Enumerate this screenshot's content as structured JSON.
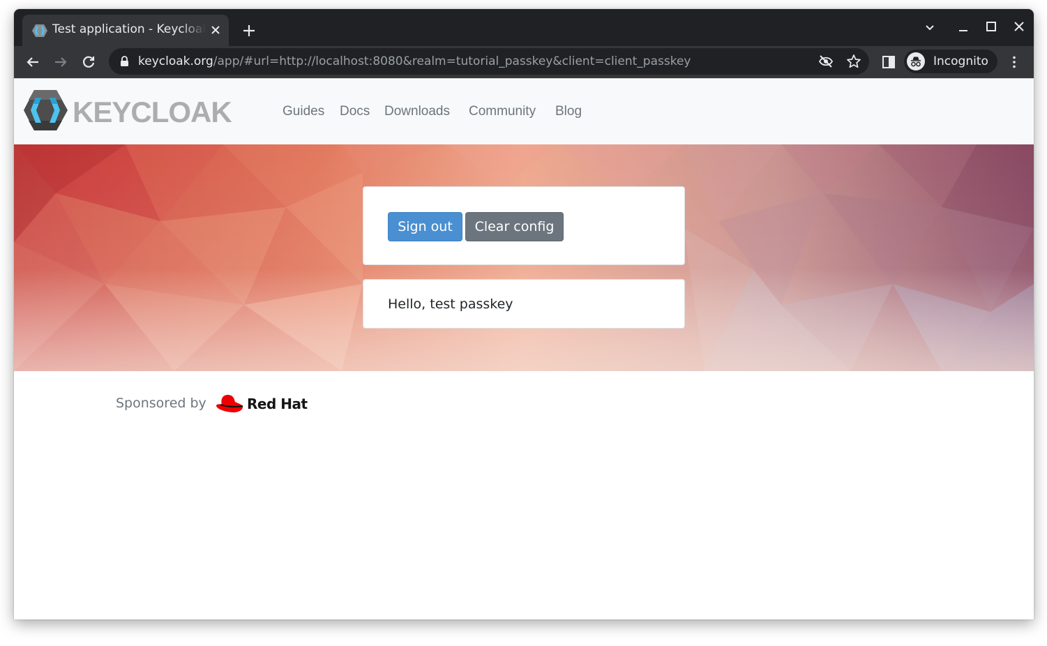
{
  "browser": {
    "tab_title": "Test application - Keycloak",
    "url_host": "keycloak.org",
    "url_rest": "/app/#url=http://localhost:8080&realm=tutorial_passkey&client=client_passkey",
    "profile_label": "Incognito"
  },
  "site": {
    "logo_text": "KEYCLOAK",
    "nav": [
      "Guides",
      "Docs",
      "Downloads",
      "Community",
      "Blog"
    ]
  },
  "actions": {
    "sign_out": "Sign out",
    "clear_config": "Clear config"
  },
  "greeting": "Hello, test passkey",
  "footer": {
    "sponsored_by": "Sponsored by",
    "sponsor_name": "Red Hat"
  },
  "colors": {
    "primary_button": "#4a8fd2",
    "secondary_button": "#6c757d",
    "redhat_red": "#ee0000"
  }
}
